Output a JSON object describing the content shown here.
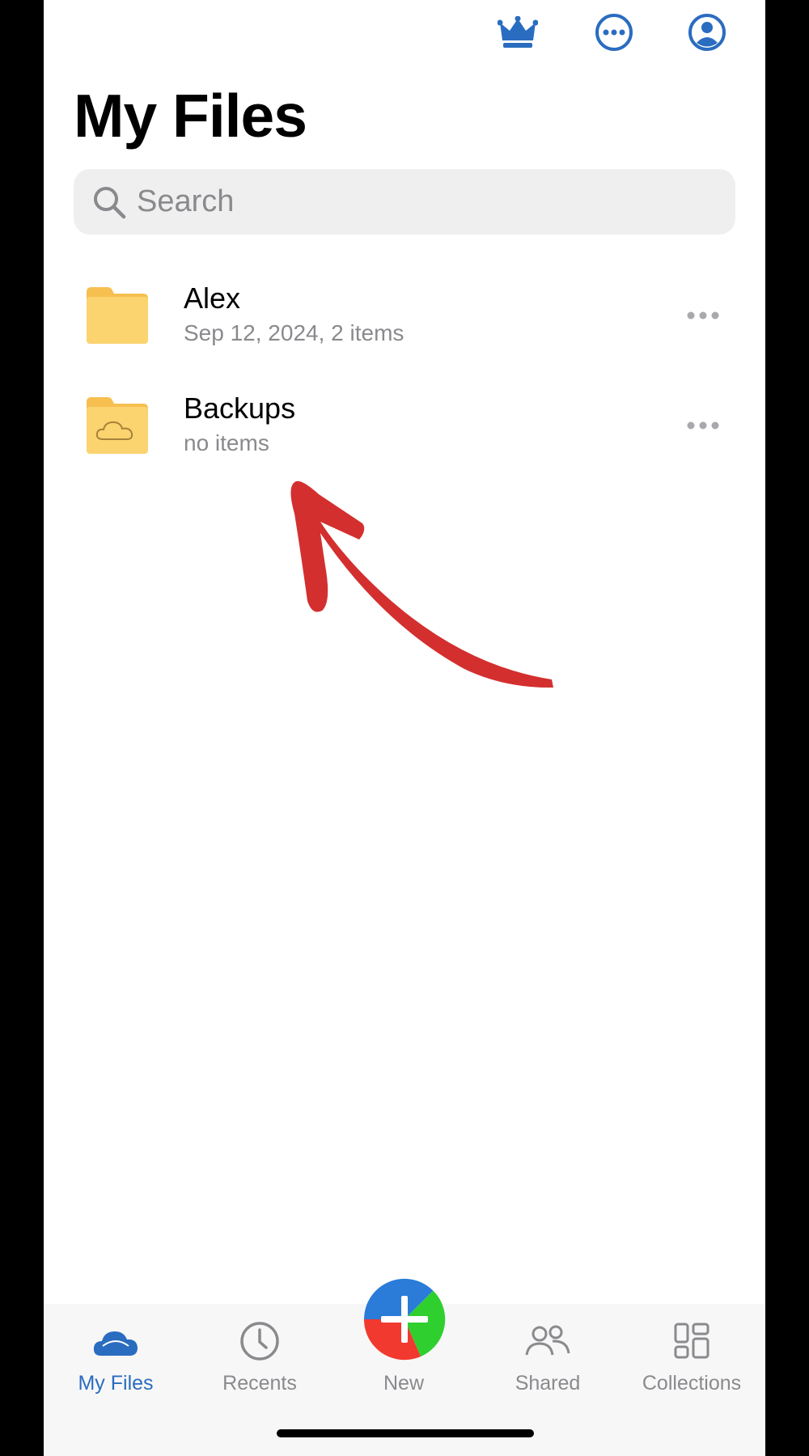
{
  "header": {
    "title": "My Files",
    "icons": [
      "crown-icon",
      "more-options-icon",
      "account-icon"
    ]
  },
  "search": {
    "placeholder": "Search",
    "value": ""
  },
  "files": [
    {
      "name": "Alex",
      "meta": "Sep 12, 2024, 2 items",
      "icon": "folder-icon"
    },
    {
      "name": "Backups",
      "meta": "no items",
      "icon": "cloud-folder-icon"
    }
  ],
  "tabbar": {
    "my_files": "My Files",
    "recents": "Recents",
    "new": "New",
    "shared": "Shared",
    "collections": "Collections"
  },
  "colors": {
    "accent": "#2a6cc0",
    "folder": "#fbd36f",
    "annotation_arrow": "#d32f2f"
  }
}
